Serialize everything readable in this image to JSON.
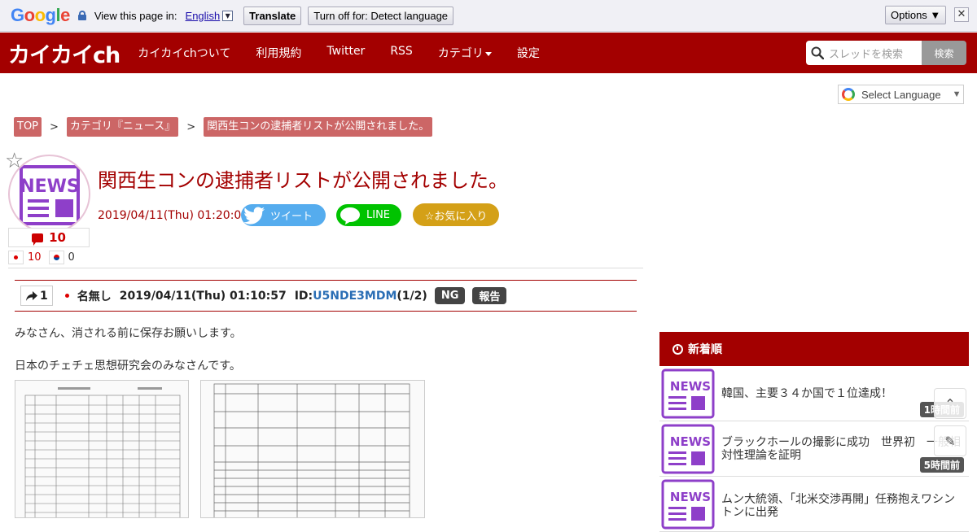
{
  "translate_bar": {
    "logo_letters": [
      "G",
      "o",
      "o",
      "g",
      "l",
      "e"
    ],
    "view_in_text": "View this page in:",
    "language": "English",
    "translate_label": "Translate",
    "turn_off_label": "Turn off for: Detect language",
    "options_label": "Options ▼",
    "close_glyph": "✕"
  },
  "nav": {
    "logo": "カイカイch",
    "links": [
      "カイカイchついて",
      "利用規約",
      "Twitter",
      "RSS",
      "カテゴリ",
      "設定"
    ],
    "search_placeholder": "スレッドを検索",
    "search_button": "検索"
  },
  "select_language": {
    "label": "Select Language",
    "arrow": "▼"
  },
  "breadcrumb": {
    "items": [
      "TOP",
      "カテゴリ『ニュース』",
      "関西生コンの逮捕者リストが公開されました。"
    ],
    "separator": ">"
  },
  "article": {
    "title": "関西生コンの逮捕者リストが公開されました。",
    "date": "2019/04/11(Thu) 01:20:01",
    "tweet_label": "ツイート",
    "line_label": "LINE",
    "favorite_label": "☆お気に入り",
    "comment_count": "10",
    "jp_count": "10",
    "kr_count": "0",
    "star_glyph": "☆"
  },
  "post": {
    "number": "1",
    "name": "名無し",
    "datetime": "2019/04/11(Thu) 01:10:57",
    "id_prefix": "ID:",
    "id": "U5NDE3MDM",
    "id_suffix": "(1/2)",
    "ng_label": "NG",
    "report_label": "報告",
    "lines": [
      "みなさん、消される前に保存お願いします。",
      "日本のチェチェ思想研究会のみなさんです。"
    ]
  },
  "sidebar": {
    "header": "新着順",
    "items": [
      {
        "title": "韓国、主要３４か国で１位達成！",
        "ago": "1時間前"
      },
      {
        "title": "ブラックホールの撮影に成功　世界初　一般相対性理論を証明",
        "ago": "5時間前"
      },
      {
        "title": "ムン大統領、「北米交渉再開」任務抱えワシントンに出発",
        "ago": ""
      }
    ]
  },
  "colors": {
    "brand": "#a30000",
    "accent_pink": "#c66",
    "news_purple": "#8e3fc9"
  }
}
